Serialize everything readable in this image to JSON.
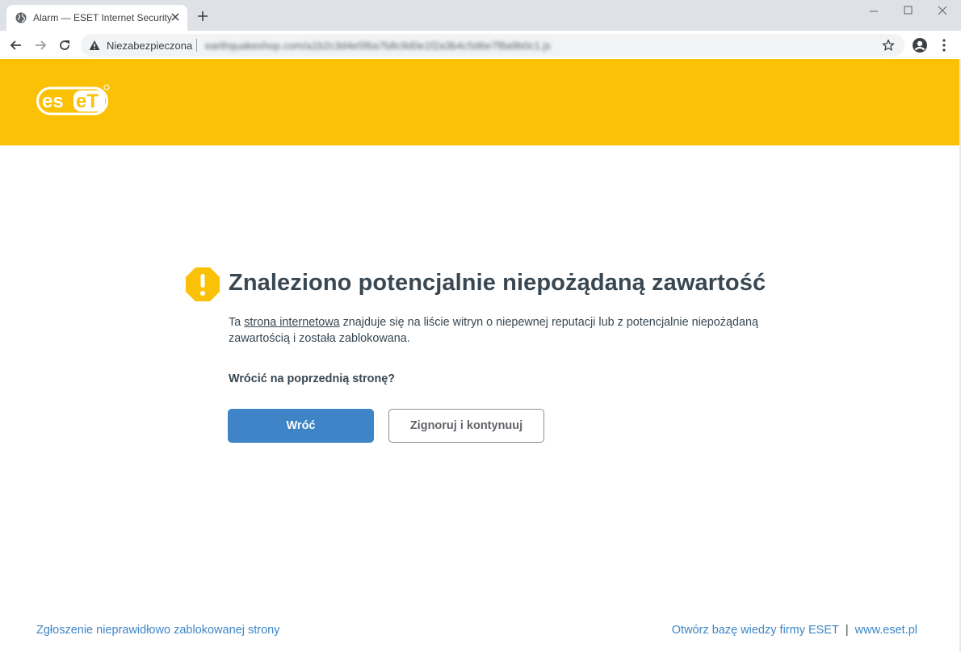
{
  "browser": {
    "tab_title": "Alarm — ESET Internet Security",
    "security_label": "Niezabezpieczona",
    "url": "earthquakeshop.com/a1b2c3d4e5f6a7b8c9d0e1f2a3b4c5d6e7f8a9b0c1.js"
  },
  "logo": {
    "text": "eset",
    "brand_color": "#fbc106"
  },
  "warning": {
    "title": "Znaleziono potencjalnie niepożądaną zawartość",
    "desc_before": "Ta ",
    "desc_link": "strona internetowa",
    "desc_after": " znajduje się na liście witryn o niepewnej reputacji lub z potencjalnie niepożądaną zawartością i została zablokowana.",
    "question": "Wrócić na poprzednią stronę?"
  },
  "buttons": {
    "back": "Wróć",
    "ignore": "Zignoruj i kontynuuj"
  },
  "footer": {
    "report_link": "Zgłoszenie nieprawidłowo zablokowanej strony",
    "kb_link": "Otwórz bazę wiedzy firmy ESET",
    "separator": "|",
    "site_link": "www.eset.pl"
  }
}
